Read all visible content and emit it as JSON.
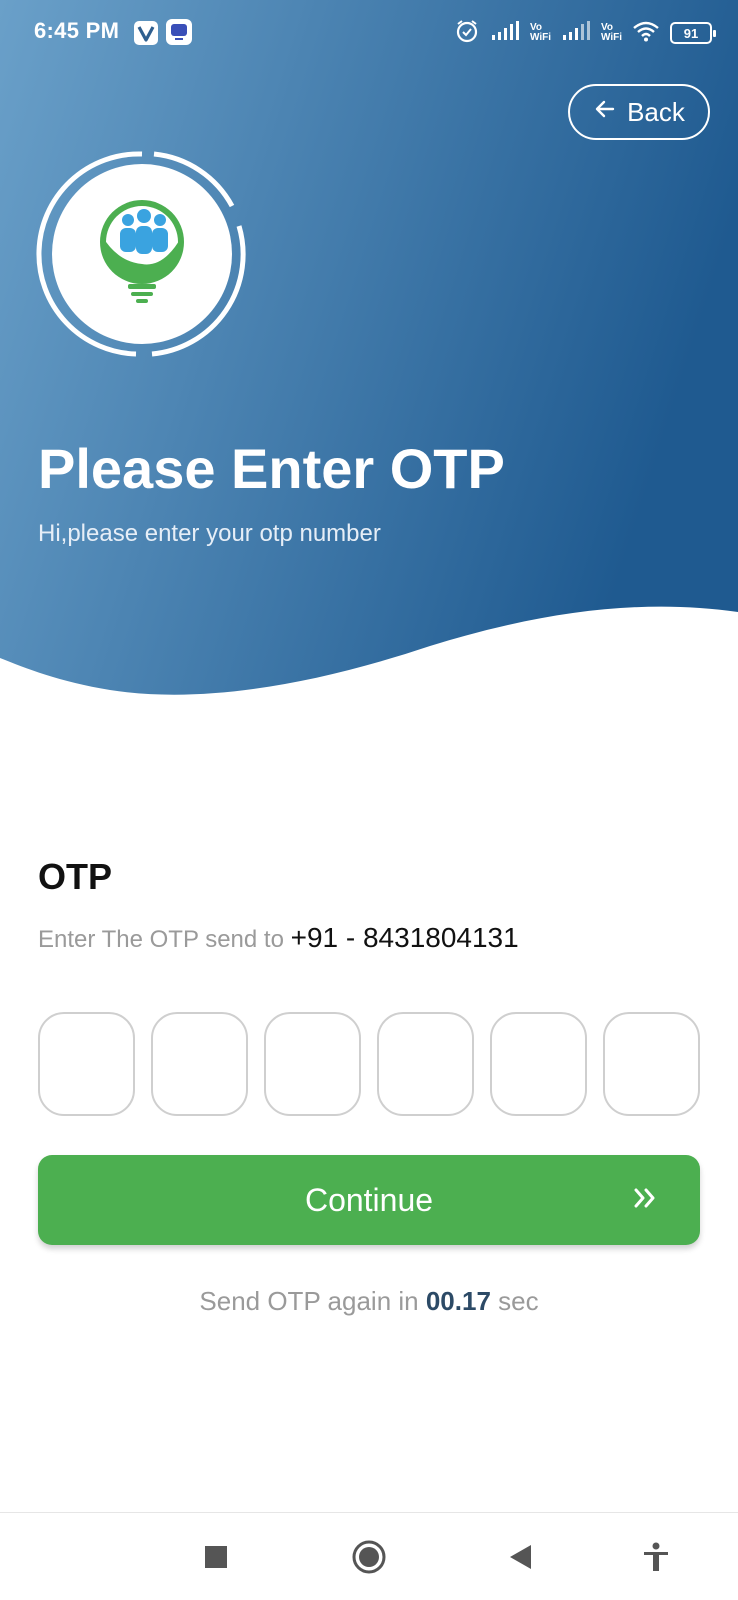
{
  "status_bar": {
    "time": "6:45 PM",
    "vowifi_1": [
      "Vo",
      "WiFi"
    ],
    "vowifi_2": [
      "Vo",
      "WiFi"
    ],
    "battery": "91"
  },
  "header": {
    "back_label": "Back",
    "title": "Please Enter OTP",
    "subtitle": "Hi,please enter your otp number",
    "gradient_start": "#6aa0c9",
    "gradient_end": "#1f5a90"
  },
  "form": {
    "otp_label": "OTP",
    "send_to_prefix": "Enter The OTP send to ",
    "phone": "+91 - 8431804131",
    "digits": [
      "",
      "",
      "",
      "",
      "",
      ""
    ],
    "continue_label": "Continue",
    "resend_prefix": "Send OTP again in ",
    "resend_timer": "00.17",
    "resend_suffix": " sec"
  },
  "colors": {
    "accent_green": "#4caf50",
    "timer_text": "#2c4a66"
  },
  "nav": {
    "icons": [
      "recents-square-icon",
      "home-circle-icon",
      "back-triangle-icon",
      "accessibility-icon"
    ]
  }
}
